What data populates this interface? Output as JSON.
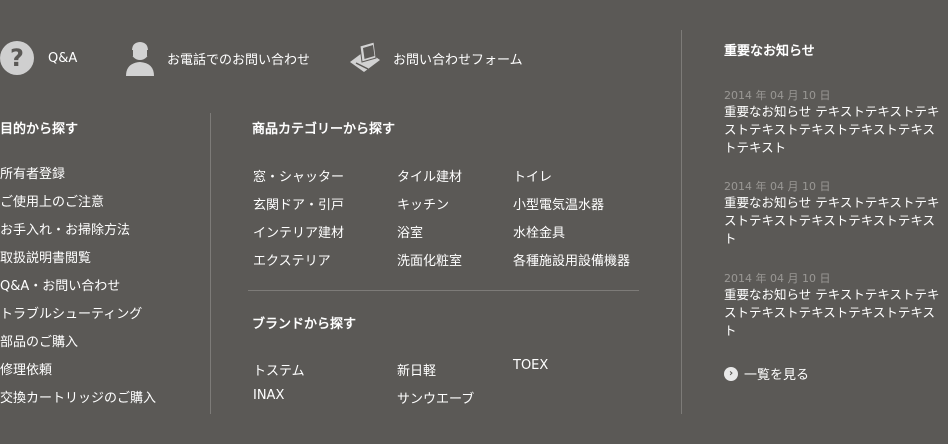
{
  "contact": {
    "qa_label": "Q&A",
    "phone_label": "お電話でのお問い合わせ",
    "form_label": "お問い合わせフォーム"
  },
  "purpose": {
    "heading": "目的から探す",
    "items": [
      "所有者登録",
      "ご使用上のご注意",
      "お手入れ・お掃除方法",
      "取扱説明書閲覧",
      "Q&A・お問い合わせ",
      "トラブルシューティング",
      "部品のご購入",
      "修理依頼",
      "交換カートリッジのご購入"
    ]
  },
  "category": {
    "heading": "商品カテゴリーから探す",
    "items": [
      "窓・シャッター",
      "タイル建材",
      "トイレ",
      "玄関ドア・引戸",
      "キッチン",
      "小型電気温水器",
      "インテリア建材",
      "浴室",
      "水栓金具",
      "エクステリア",
      "洗面化粧室",
      "各種施設用設備機器"
    ]
  },
  "brand": {
    "heading": "ブランドから探す",
    "items": [
      "トステム",
      "新日軽",
      "TOEX",
      "INAX",
      "サンウエーブ"
    ]
  },
  "news": {
    "heading": "重要なお知らせ",
    "items": [
      {
        "date": "2014 年 04 月 10 日",
        "text": "重要なお知らせ テキストテキストテキストテキストテキストテキストテキストテキスト"
      },
      {
        "date": "2014 年 04 月 10 日",
        "text": "重要なお知らせ テキストテキストテキストテキストテキストテキストテキスト"
      },
      {
        "date": "2014 年 04 月 10 日",
        "text": "重要なお知らせ テキストテキストテキストテキストテキストテキストテキスト"
      }
    ],
    "more_label": "一覧を見る"
  }
}
